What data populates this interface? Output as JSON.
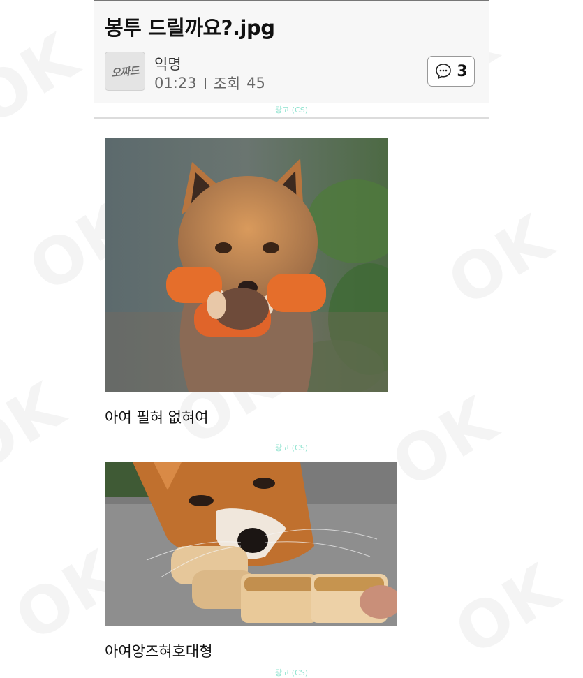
{
  "post": {
    "title": "봉투 드릴까요?.jpg",
    "author": "익명",
    "time": "01:23",
    "views_label": "조회",
    "views": "45",
    "comment_count": "3",
    "site_logo_text": "오짜드"
  },
  "ads": {
    "label_top": "광고 (CS)",
    "label_mid": "광고 (CS)",
    "label_bottom": "광고 (CS)"
  },
  "content": {
    "images": [
      {
        "caption": "아여 필혀 없혀여",
        "subject": "fox-holding-carrots"
      },
      {
        "caption": "아여앙즈혀호대형",
        "subject": "fox-eating-bread"
      }
    ]
  },
  "icons": {
    "comment": "speech-bubble-icon"
  },
  "colors": {
    "header_bg": "#f7f7f7",
    "ad_label": "#8fe3cf",
    "text": "#111111",
    "meta_text": "#666666"
  }
}
